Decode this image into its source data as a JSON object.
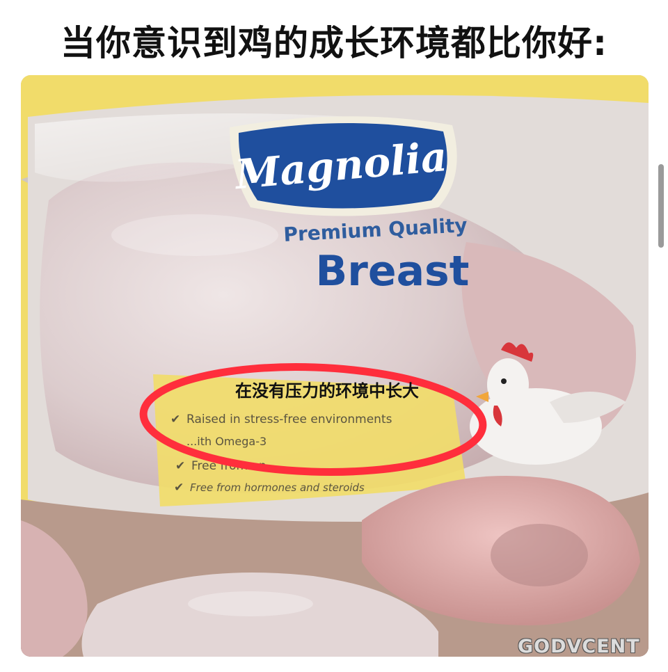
{
  "caption": "当你意识到鸡的成长环境都比你好:",
  "package": {
    "brand": "Magnolia",
    "subtitle": "Premium Quality",
    "product": "Breast"
  },
  "overlay_text": "在没有压力的环境中长大",
  "claims": [
    "Raised in stress-free environments",
    "...ith Omega-3",
    "Free from an...",
    "Free from hormones and steroids"
  ],
  "watermark": "GODVCENT",
  "colors": {
    "highlight_circle": "#ff2e3c",
    "brand_blue": "#1f4f9e",
    "package_yellow": "#f1dc6a"
  }
}
